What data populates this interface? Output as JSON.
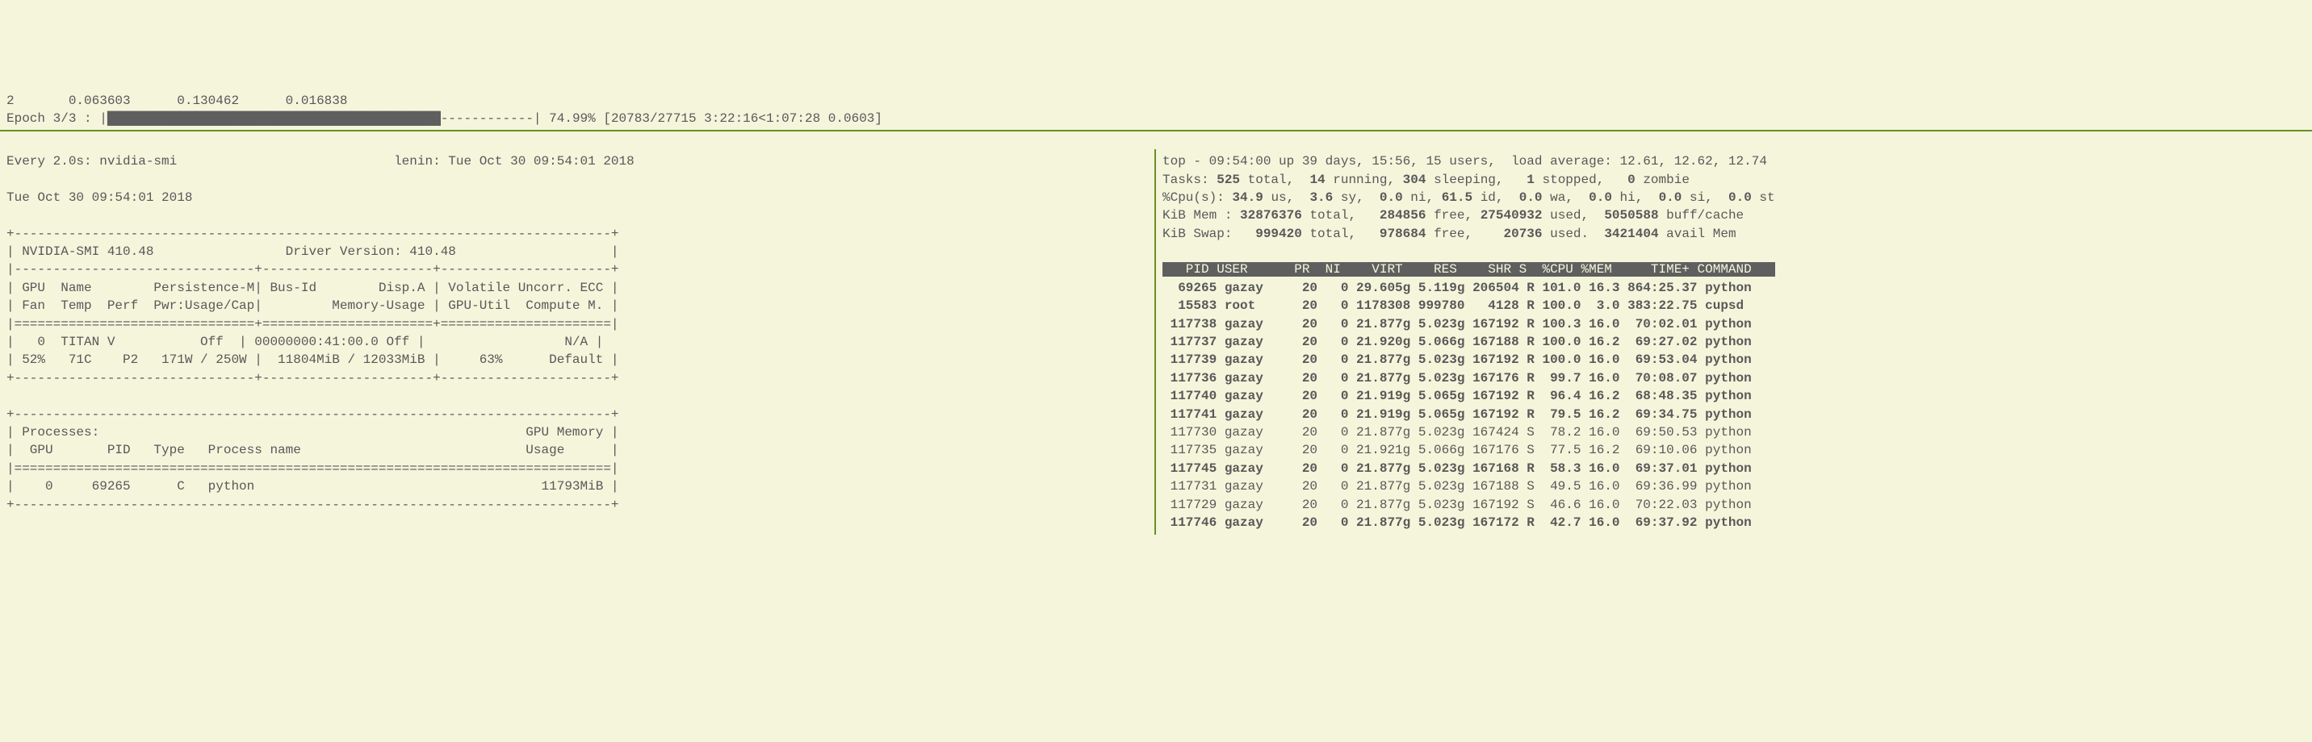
{
  "training": {
    "loss_row": "2       0.063603      0.130462      0.016838",
    "epoch_label": "Epoch 3/3 : |",
    "progress_filled": "███████████████████████████████████████████",
    "progress_empty": "------------|",
    "progress_stats": " 74.99% [20783/27715 3:22:16<1:07:28 0.0603]"
  },
  "watch": {
    "header": "Every 2.0s: nvidia-smi                            lenin: Tue Oct 30 09:54:01 2018",
    "date": "Tue Oct 30 09:54:01 2018",
    "smi_line1": "+-----------------------------------------------------------------------------+",
    "smi_line2": "| NVIDIA-SMI 410.48                 Driver Version: 410.48                    |",
    "smi_line3": "|-------------------------------+----------------------+----------------------+",
    "smi_line4": "| GPU  Name        Persistence-M| Bus-Id        Disp.A | Volatile Uncorr. ECC |",
    "smi_line5": "| Fan  Temp  Perf  Pwr:Usage/Cap|         Memory-Usage | GPU-Util  Compute M. |",
    "smi_line6": "|===============================+======================+======================|",
    "smi_line7": "|   0  TITAN V           Off  | 00000000:41:00.0 Off |                  N/A |",
    "smi_line8": "| 52%   71C    P2   171W / 250W |  11804MiB / 12033MiB |     63%      Default |",
    "smi_line9": "+-------------------------------+----------------------+----------------------+",
    "proc_line1": "+-----------------------------------------------------------------------------+",
    "proc_line2": "| Processes:                                                       GPU Memory |",
    "proc_line3": "|  GPU       PID   Type   Process name                             Usage      |",
    "proc_line4": "|=============================================================================|",
    "proc_line5": "|    0     69265      C   python                                     11793MiB |",
    "proc_line6": "+-----------------------------------------------------------------------------+"
  },
  "top": {
    "line1_a": "top - 09:54:00 up 39 days, 15:56, 15 users,  load average: 12.61, 12.62, 12.74",
    "line2_a": "Tasks: ",
    "line2_b": "525 ",
    "line2_c": "total,  ",
    "line2_d": "14 ",
    "line2_e": "running, ",
    "line2_f": "304 ",
    "line2_g": "sleeping,   ",
    "line2_h": "1 ",
    "line2_i": "stopped,   ",
    "line2_j": "0 ",
    "line2_k": "zombie",
    "line3_a": "%Cpu(s): ",
    "line3_b": "34.9 ",
    "line3_c": "us,  ",
    "line3_d": "3.6 ",
    "line3_e": "sy,  ",
    "line3_f": "0.0 ",
    "line3_g": "ni, ",
    "line3_h": "61.5 ",
    "line3_i": "id,  ",
    "line3_j": "0.0 ",
    "line3_k": "wa,  ",
    "line3_l": "0.0 ",
    "line3_m": "hi,  ",
    "line3_n": "0.0 ",
    "line3_o": "si,  ",
    "line3_p": "0.0 ",
    "line3_q": "st",
    "line4_a": "KiB Mem : ",
    "line4_b": "32876376 ",
    "line4_c": "total,   ",
    "line4_d": "284856 ",
    "line4_e": "free, ",
    "line4_f": "27540932 ",
    "line4_g": "used,  ",
    "line4_h": "5050588 ",
    "line4_i": "buff/cache",
    "line5_a": "KiB Swap:   ",
    "line5_b": "999420 ",
    "line5_c": "total,   ",
    "line5_d": "978684 ",
    "line5_e": "free,    ",
    "line5_f": "20736 ",
    "line5_g": "used.  ",
    "line5_h": "3421404 ",
    "line5_i": "avail Mem",
    "header": "   PID USER      PR  NI    VIRT    RES    SHR S  %CPU %MEM     TIME+ COMMAND   ",
    "rows": [
      {
        "text": "  69265 gazay     20   0 29.605g 5.119g 206504 R 101.0 16.3 864:25.37 python",
        "bold": true
      },
      {
        "text": "  15583 root      20   0 1178308 999780   4128 R 100.0  3.0 383:22.75 cupsd",
        "bold": true
      },
      {
        "text": " 117738 gazay     20   0 21.877g 5.023g 167192 R 100.3 16.0  70:02.01 python",
        "bold": true
      },
      {
        "text": " 117737 gazay     20   0 21.920g 5.066g 167188 R 100.0 16.2  69:27.02 python",
        "bold": true
      },
      {
        "text": " 117739 gazay     20   0 21.877g 5.023g 167192 R 100.0 16.0  69:53.04 python",
        "bold": true
      },
      {
        "text": " 117736 gazay     20   0 21.877g 5.023g 167176 R  99.7 16.0  70:08.07 python",
        "bold": true
      },
      {
        "text": " 117740 gazay     20   0 21.919g 5.065g 167192 R  96.4 16.2  68:48.35 python",
        "bold": true
      },
      {
        "text": " 117741 gazay     20   0 21.919g 5.065g 167192 R  79.5 16.2  69:34.75 python",
        "bold": true
      },
      {
        "text": " 117730 gazay     20   0 21.877g 5.023g 167424 S  78.2 16.0  69:50.53 python",
        "bold": false
      },
      {
        "text": " 117735 gazay     20   0 21.921g 5.066g 167176 S  77.5 16.2  69:10.06 python",
        "bold": false
      },
      {
        "text": " 117745 gazay     20   0 21.877g 5.023g 167168 R  58.3 16.0  69:37.01 python",
        "bold": true
      },
      {
        "text": " 117731 gazay     20   0 21.877g 5.023g 167188 S  49.5 16.0  69:36.99 python",
        "bold": false
      },
      {
        "text": " 117729 gazay     20   0 21.877g 5.023g 167192 S  46.6 16.0  70:22.03 python",
        "bold": false
      },
      {
        "text": " 117746 gazay     20   0 21.877g 5.023g 167172 R  42.7 16.0  69:37.92 python",
        "bold": true
      }
    ]
  }
}
